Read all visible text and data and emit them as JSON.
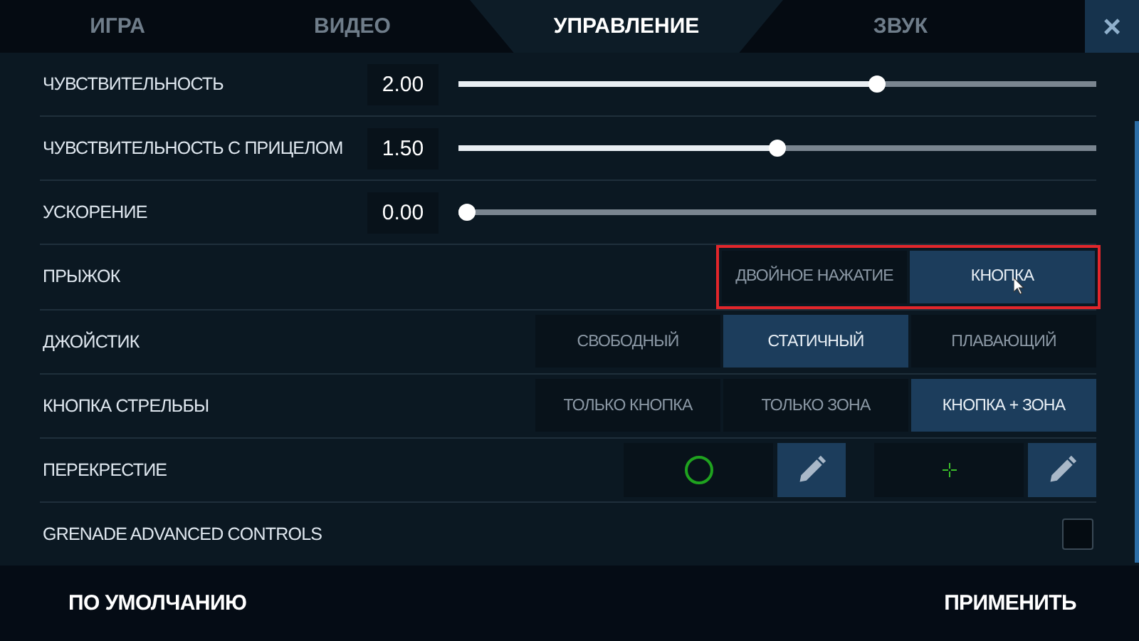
{
  "tabs": [
    {
      "label": "ИГРА",
      "selected": false
    },
    {
      "label": "ВИДЕО",
      "selected": false
    },
    {
      "label": "УПРАВЛЕНИЕ",
      "selected": true
    },
    {
      "label": "ЗВУК",
      "selected": false
    }
  ],
  "close": "×",
  "rows": [
    {
      "kind": "slider",
      "label": "ЧУВСТВИТЕЛЬНОСТЬ",
      "value": "2.00",
      "level": 0.66
    },
    {
      "kind": "slider",
      "label": "ЧУВСТВИТЕЛЬНОСТЬ С ПРИЦЕЛОМ",
      "value": "1.50",
      "level": 0.5
    },
    {
      "kind": "slider",
      "label": "УСКОРЕНИЕ",
      "value": "0.00",
      "level": 0
    },
    {
      "kind": "segment",
      "label": "ПРЫЖОК",
      "highlighted": true,
      "options": [
        {
          "label": "ДВОЙНОЕ НАЖАТИЕ",
          "selected": false
        },
        {
          "label": "КНОПКА",
          "selected": true
        }
      ]
    },
    {
      "kind": "segment",
      "label": "ДЖОЙСТИК",
      "highlighted": false,
      "options": [
        {
          "label": "СВОБОДНЫЙ",
          "selected": false
        },
        {
          "label": "СТАТИЧНЫЙ",
          "selected": true
        },
        {
          "label": "ПЛАВАЮЩИЙ",
          "selected": false
        }
      ]
    },
    {
      "kind": "segment",
      "label": "КНОПКА СТРЕЛЬБЫ",
      "highlighted": false,
      "options": [
        {
          "label": "ТОЛЬКО КНОПКА",
          "selected": false
        },
        {
          "label": "ТОЛЬКО ЗОНА",
          "selected": false
        },
        {
          "label": "КНОПКА + ЗОНА",
          "selected": true
        }
      ]
    },
    {
      "kind": "crosshair",
      "label": "ПЕРЕКРЕСТИЕ"
    },
    {
      "kind": "checkbox",
      "label": "GRENADE ADVANCED CONTROLS",
      "checked": false
    }
  ],
  "footer": {
    "left": "ПО УМОЛЧАНИЮ",
    "right": "ПРИМЕНИТЬ"
  }
}
